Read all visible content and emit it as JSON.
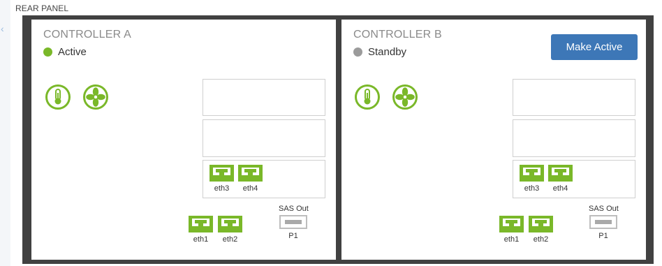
{
  "panel": {
    "title": "REAR PANEL"
  },
  "nav": {
    "collapse_glyph": "‹"
  },
  "colors": {
    "accent_green": "#7ab829",
    "chassis": "#414141",
    "button_blue": "#3d77b7",
    "active_dot": "#7ab829",
    "standby_dot": "#9b9b9b"
  },
  "controller_a": {
    "title": "CONTROLLER A",
    "status": "Active",
    "icons": [
      "thermometer-icon",
      "fan-icon"
    ],
    "slot_ports": [
      "eth3",
      "eth4"
    ],
    "onboard_ports": [
      "eth1",
      "eth2"
    ],
    "sas": {
      "title": "SAS Out",
      "port": "P1"
    }
  },
  "controller_b": {
    "title": "CONTROLLER B",
    "status": "Standby",
    "button": "Make Active",
    "icons": [
      "thermometer-icon",
      "fan-icon"
    ],
    "slot_ports": [
      "eth3",
      "eth4"
    ],
    "onboard_ports": [
      "eth1",
      "eth2"
    ],
    "sas": {
      "title": "SAS Out",
      "port": "P1"
    }
  }
}
